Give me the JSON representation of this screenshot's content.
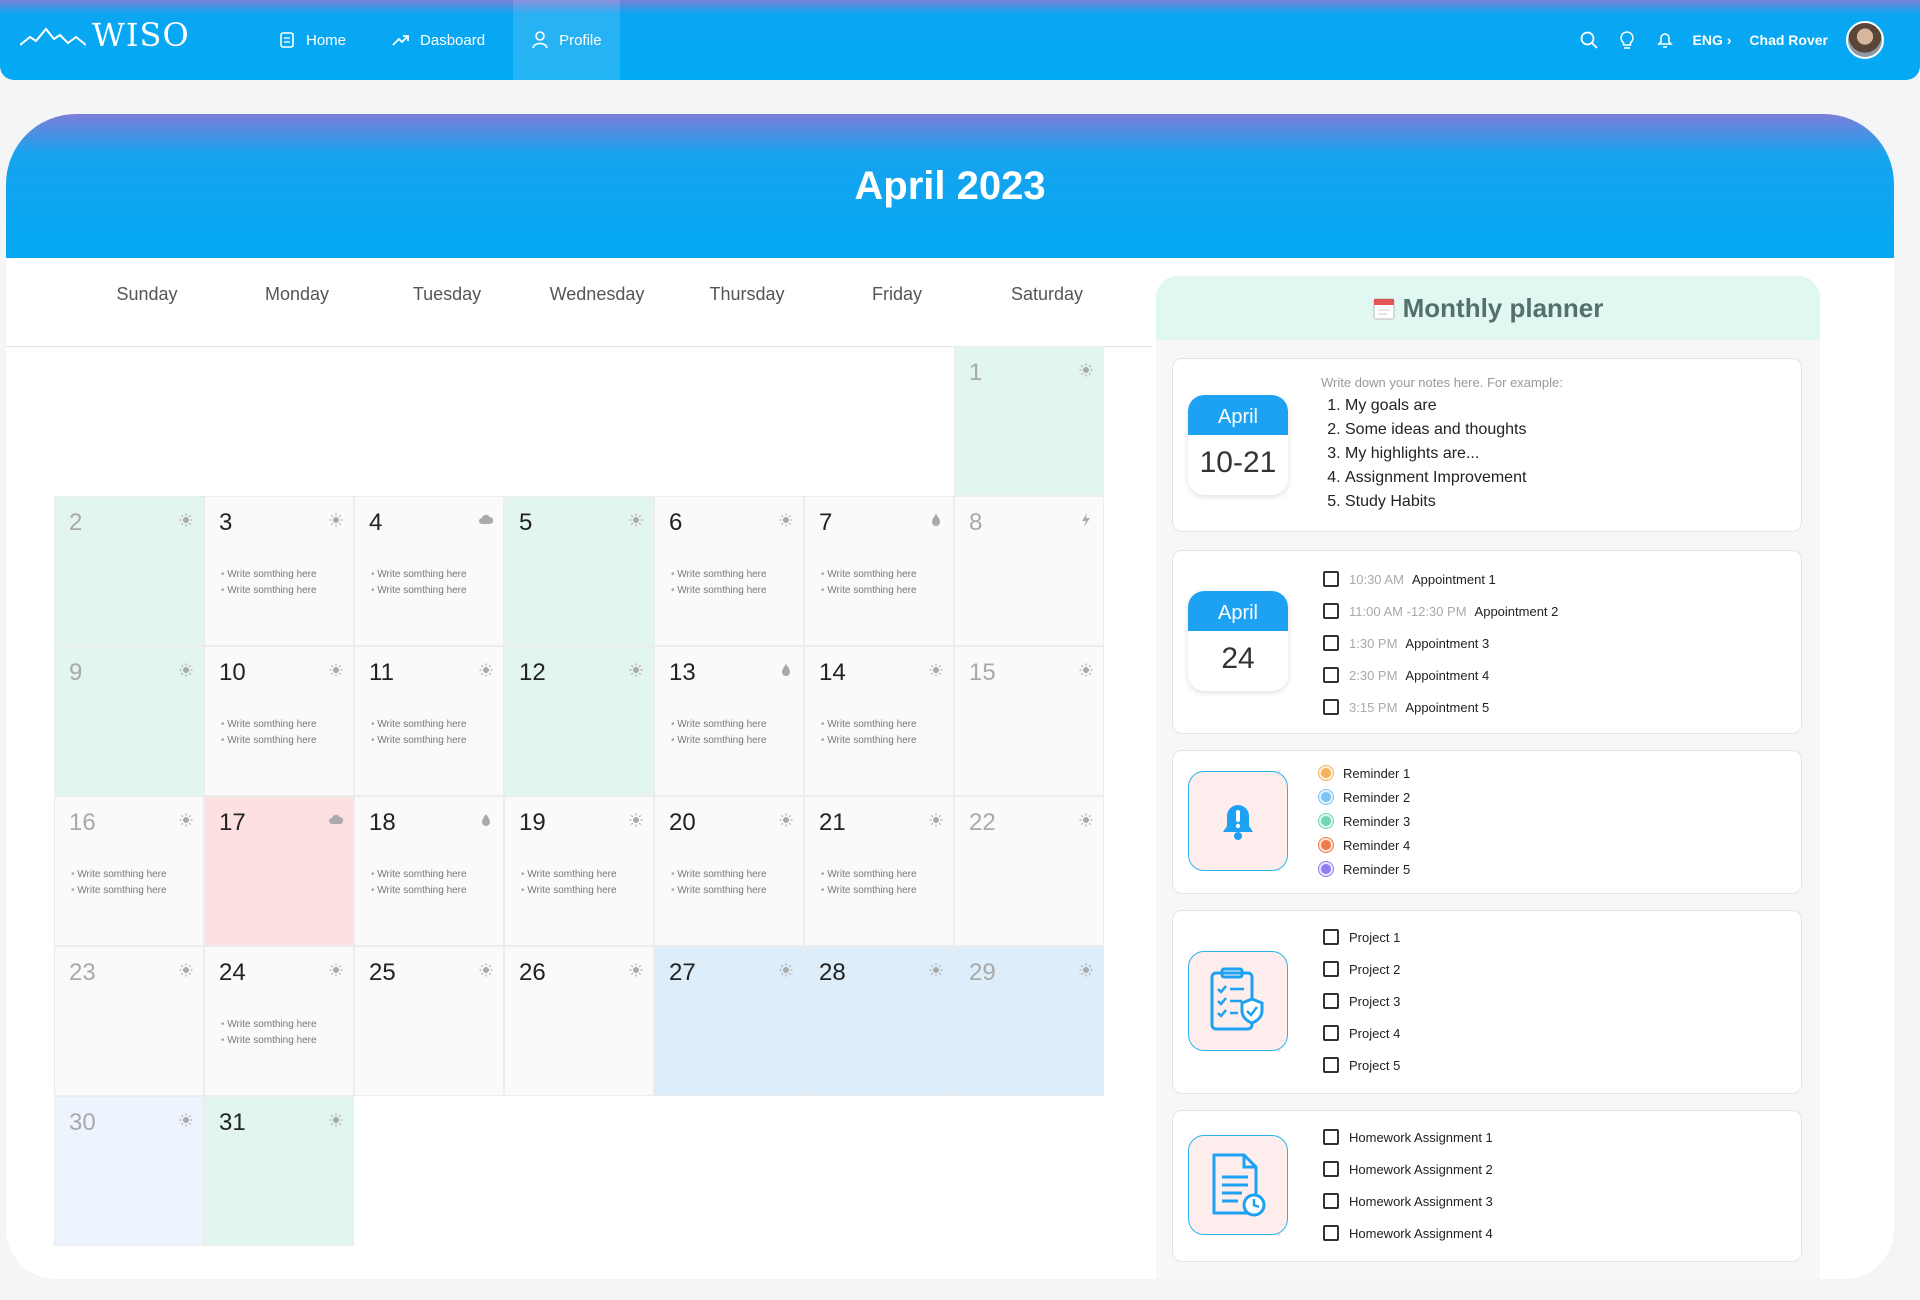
{
  "nav": {
    "logo": "WISO",
    "items": [
      {
        "label": "Home",
        "icon": "home-icon"
      },
      {
        "label": "Dasboard",
        "icon": "chart-trend-icon"
      },
      {
        "label": "Profile",
        "icon": "user-icon"
      }
    ],
    "language": "ENG ›",
    "user_name": "Chad Rover"
  },
  "calendar": {
    "title": "April 2023",
    "weekdays": [
      "Sunday",
      "Monday",
      "Tuesday",
      "Wednesday",
      "Thursday",
      "Friday",
      "Saturday"
    ],
    "note_text": "Write somthing here",
    "days": [
      {
        "n": "1",
        "icon": "sun",
        "color": "green"
      },
      {
        "n": "2",
        "icon": "sun",
        "color": "green"
      },
      {
        "n": "3",
        "icon": "sun",
        "notes": true
      },
      {
        "n": "4",
        "icon": "cloud",
        "notes": true
      },
      {
        "n": "5",
        "icon": "sun",
        "color": "green"
      },
      {
        "n": "6",
        "icon": "sun",
        "notes": true
      },
      {
        "n": "7",
        "icon": "drop",
        "notes": true
      },
      {
        "n": "8",
        "icon": "bolt"
      },
      {
        "n": "9",
        "icon": "sun",
        "color": "green"
      },
      {
        "n": "10",
        "icon": "sun",
        "notes": true
      },
      {
        "n": "11",
        "icon": "sun",
        "notes": true
      },
      {
        "n": "12",
        "icon": "sun",
        "color": "green"
      },
      {
        "n": "13",
        "icon": "drop",
        "notes": true
      },
      {
        "n": "14",
        "icon": "sun",
        "notes": true
      },
      {
        "n": "15",
        "icon": "sun"
      },
      {
        "n": "16",
        "icon": "sun",
        "notes": true
      },
      {
        "n": "17",
        "icon": "cloud",
        "color": "pink"
      },
      {
        "n": "18",
        "icon": "drop",
        "notes": true
      },
      {
        "n": "19",
        "icon": "sun",
        "notes": true
      },
      {
        "n": "20",
        "icon": "sun",
        "notes": true
      },
      {
        "n": "21",
        "icon": "sun",
        "notes": true
      },
      {
        "n": "22",
        "icon": "sun"
      },
      {
        "n": "23",
        "icon": "sun"
      },
      {
        "n": "24",
        "icon": "sun",
        "notes": true
      },
      {
        "n": "25",
        "icon": "sun"
      },
      {
        "n": "26",
        "icon": "sun"
      },
      {
        "n": "27",
        "icon": "sun",
        "color": "blue"
      },
      {
        "n": "28",
        "icon": "sun",
        "color": "blue"
      },
      {
        "n": "29",
        "icon": "sun",
        "color": "blue"
      },
      {
        "n": "30",
        "icon": "sun",
        "color": "lightblue"
      },
      {
        "n": "31",
        "icon": "sun",
        "color": "green"
      }
    ]
  },
  "planner": {
    "title": "Monthly planner",
    "notes_card": {
      "month": "April",
      "range": "10-21",
      "hint": "Write down your notes here. For example:",
      "items": [
        "My goals are",
        "Some ideas and thoughts",
        "My highlights are...",
        "Assignment Improvement",
        "Study Habits"
      ]
    },
    "appointments_card": {
      "month": "April",
      "day": "24",
      "items": [
        {
          "time": "10:30 AM",
          "label": "Appointment 1"
        },
        {
          "time": "11:00 AM -12:30 PM",
          "label": "Appointment 2"
        },
        {
          "time": "1:30 PM",
          "label": "Appointment 3"
        },
        {
          "time": "2:30 PM",
          "label": "Appointment 4"
        },
        {
          "time": "3:15 PM",
          "label": "Appointment 5"
        }
      ]
    },
    "reminders": [
      {
        "label": "Reminder 1",
        "color": "#f5b25a"
      },
      {
        "label": "Reminder 2",
        "color": "#7cc4f5"
      },
      {
        "label": "Reminder 3",
        "color": "#6fd6b3"
      },
      {
        "label": "Reminder 4",
        "color": "#f07a45"
      },
      {
        "label": "Reminder 5",
        "color": "#8f7cf0"
      }
    ],
    "projects": [
      "Project 1",
      "Project 2",
      "Project 3",
      "Project 4",
      "Project 5"
    ],
    "homework": [
      "Homework Assignment 1",
      "Homework Assignment 2",
      "Homework Assignment 3",
      "Homework Assignment 4"
    ]
  }
}
